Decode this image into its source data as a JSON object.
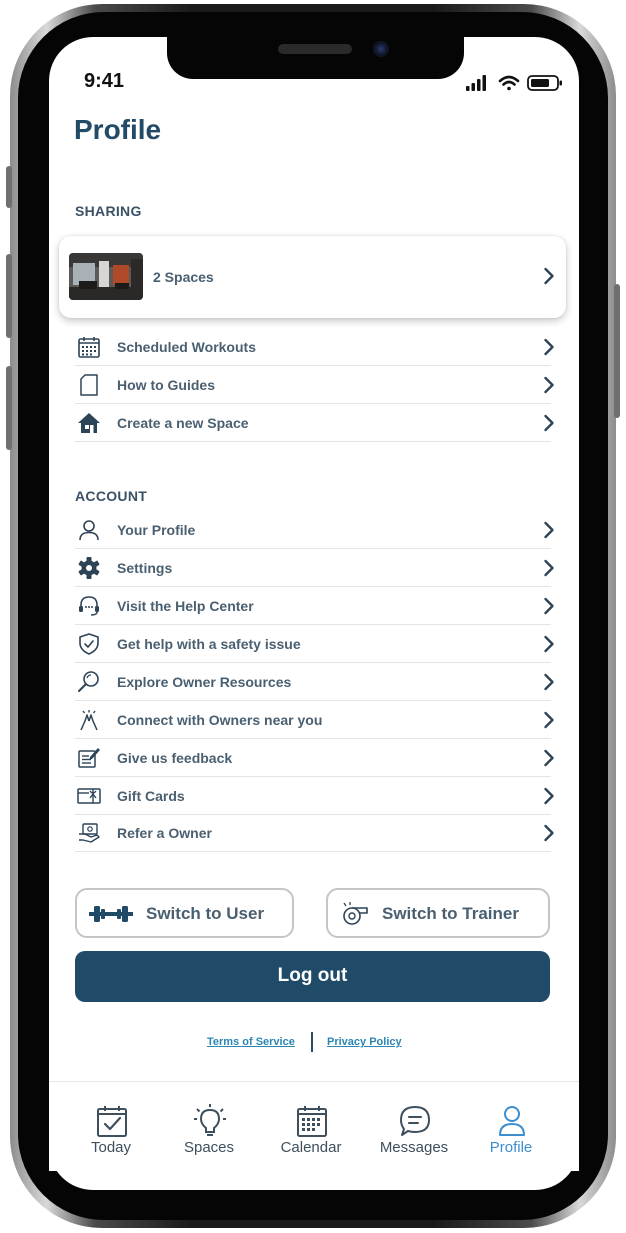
{
  "status_bar": {
    "time": "9:41"
  },
  "page_title": "Profile",
  "sharing": {
    "section_label": "SHARING",
    "spaces_card_label": "2 Spaces",
    "items": [
      {
        "label": "Scheduled Workouts",
        "icon": "calendar-grid-icon"
      },
      {
        "label": "How to Guides",
        "icon": "document-icon"
      },
      {
        "label": "Create a new Space",
        "icon": "house-icon"
      }
    ]
  },
  "account": {
    "section_label": "ACCOUNT",
    "items": [
      {
        "label": "Your Profile",
        "icon": "user-icon"
      },
      {
        "label": "Settings",
        "icon": "gear-icon"
      },
      {
        "label": "Visit the Help Center",
        "icon": "headset-icon"
      },
      {
        "label": "Get help with a safety issue",
        "icon": "shield-check-icon"
      },
      {
        "label": "Explore Owner Resources",
        "icon": "magnifier-icon"
      },
      {
        "label": "Connect with Owners near you",
        "icon": "high-five-icon"
      },
      {
        "label": "Give us feedback",
        "icon": "feedback-pencil-icon"
      },
      {
        "label": "Gift Cards",
        "icon": "gift-card-icon"
      },
      {
        "label": "Refer a Owner",
        "icon": "refer-icon"
      }
    ]
  },
  "buttons": {
    "switch_user": "Switch to User",
    "switch_trainer": "Switch to Trainer",
    "logout": "Log out"
  },
  "legal": {
    "terms": "Terms of Service",
    "privacy": "Privacy Policy"
  },
  "tabbar": {
    "tabs": [
      {
        "label": "Today",
        "icon": "calendar-check-icon"
      },
      {
        "label": "Spaces",
        "icon": "lightbulb-icon"
      },
      {
        "label": "Calendar",
        "icon": "calendar-icon"
      },
      {
        "label": "Messages",
        "icon": "chat-bubble-icon"
      },
      {
        "label": "Profile",
        "icon": "user-icon"
      }
    ],
    "active_tab": "Profile"
  },
  "colors": {
    "title": "#234a66",
    "text": "#4a5f70",
    "primary": "#1f4a68",
    "link": "#2c86b4",
    "active_tab": "#3b8ed0"
  }
}
